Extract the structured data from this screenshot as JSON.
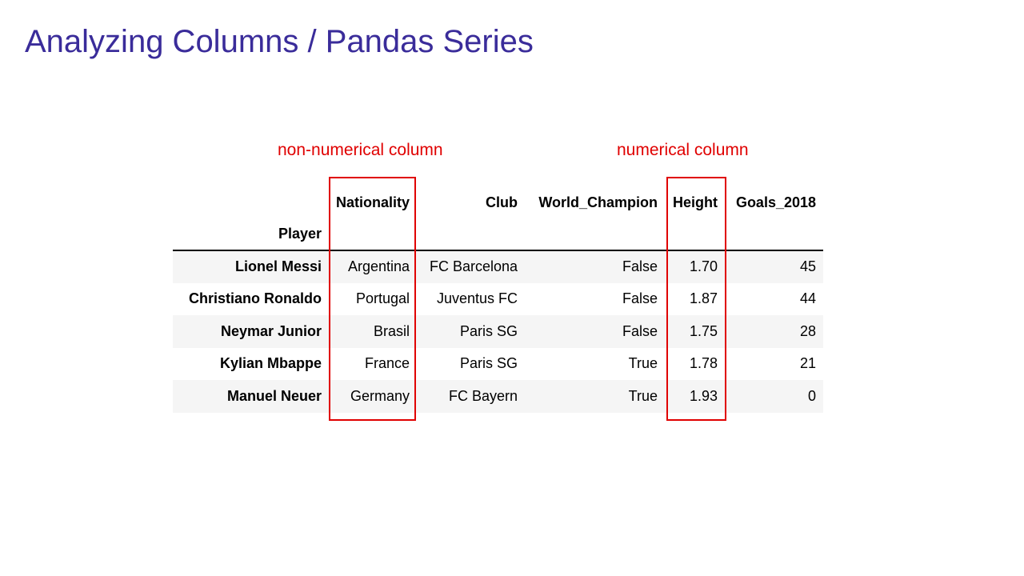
{
  "slide": {
    "title": "Analyzing Columns / Pandas Series",
    "annotations": {
      "non_numerical": "non-numerical column",
      "numerical": "numerical column"
    },
    "accent_colors": {
      "title": "#3a2c9a",
      "highlight": "#e00000"
    }
  },
  "table": {
    "columns": [
      "Nationality",
      "Club",
      "World_Champion",
      "Height",
      "Goals_2018"
    ],
    "index_name": "Player",
    "rows": [
      {
        "player": "Lionel Messi",
        "values": [
          "Argentina",
          "FC Barcelona",
          "False",
          "1.70",
          "45"
        ]
      },
      {
        "player": "Christiano Ronaldo",
        "values": [
          "Portugal",
          "Juventus FC",
          "False",
          "1.87",
          "44"
        ]
      },
      {
        "player": "Neymar Junior",
        "values": [
          "Brasil",
          "Paris SG",
          "False",
          "1.75",
          "28"
        ]
      },
      {
        "player": "Kylian Mbappe",
        "values": [
          "France",
          "Paris SG",
          "True",
          "1.78",
          "21"
        ]
      },
      {
        "player": "Manuel Neuer",
        "values": [
          "Germany",
          "FC Bayern",
          "True",
          "1.93",
          "0"
        ]
      }
    ]
  }
}
